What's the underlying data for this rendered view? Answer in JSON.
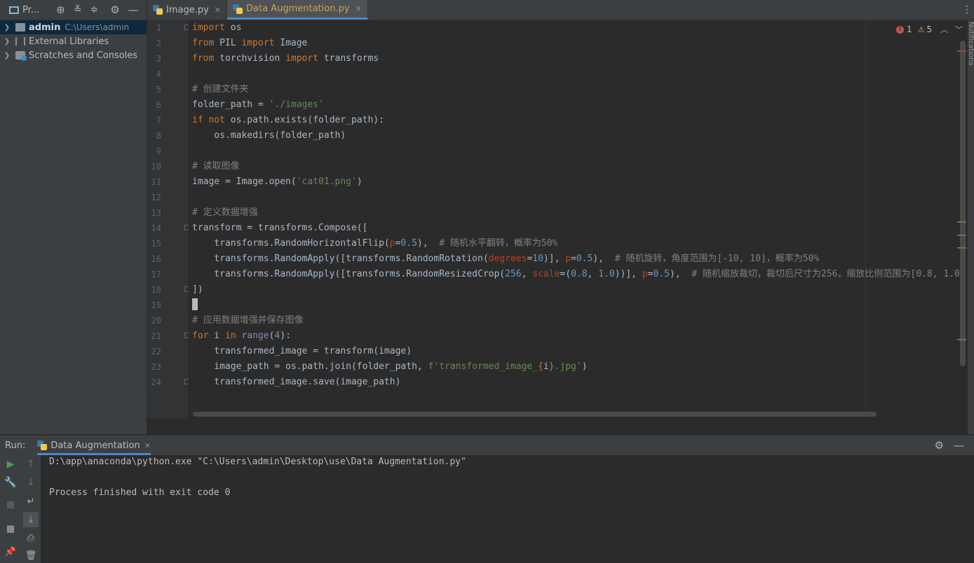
{
  "project": {
    "title": "Pr...",
    "tree": [
      {
        "name": "admin",
        "path": "C:\\Users\\admin"
      },
      {
        "name": "External Libraries"
      },
      {
        "name": "Scratches and Consoles"
      }
    ]
  },
  "tabs": [
    {
      "label": "Image.py"
    },
    {
      "label": "Data Augmentation.py"
    }
  ],
  "inspection": {
    "errors": "1",
    "warnings": "5"
  },
  "notifications_label": "Notifications",
  "line_numbers": [
    "1",
    "2",
    "3",
    "4",
    "5",
    "6",
    "7",
    "8",
    "9",
    "10",
    "11",
    "12",
    "13",
    "14",
    "15",
    "16",
    "17",
    "18",
    "19",
    "20",
    "21",
    "22",
    "23",
    "24"
  ],
  "code": {
    "l1": [
      "import",
      " os"
    ],
    "l2": [
      "from",
      " PIL ",
      "import",
      " Image"
    ],
    "l3": [
      "from",
      " torchvision ",
      "import",
      " transforms"
    ],
    "l5": "# 创建文件夹",
    "l6": [
      "folder_path = ",
      "'./images'"
    ],
    "l7": [
      "if not",
      " os.path.exists(folder_path):"
    ],
    "l8": "    os.makedirs(folder_path)",
    "l10": "# 读取图像",
    "l11": [
      "image = Image.open(",
      "'cat01.png'",
      ")"
    ],
    "l13": "# 定义数据增强",
    "l14": "transform = transforms.Compose([",
    "l15": [
      "    transforms.RandomHorizontalFlip(",
      "p",
      "=",
      "0.5",
      "),  ",
      "# 随机水平翻转，概率为50%"
    ],
    "l16": [
      "    transforms.RandomApply([transforms.RandomRotation(",
      "degrees",
      "=",
      "10",
      ")], ",
      "p",
      "=",
      "0.5",
      "),  ",
      "# 随机旋转，角度范围为[-10, 10]，概率为50%"
    ],
    "l17": [
      "    transforms.RandomApply([transforms.RandomResizedCrop(",
      "256",
      ", ",
      "scale",
      "=(",
      "0.8",
      ", ",
      "1.0",
      "))], ",
      "p",
      "=",
      "0.5",
      "),  ",
      "# 随机缩放裁切，裁切后尺寸为256，缩放比例范围为[0.8, 1.0"
    ],
    "l18": "])",
    "l20": "# 应用数据增强并保存图像",
    "l21": [
      "for",
      " i ",
      "in",
      " ",
      "range",
      "(",
      "4",
      "):"
    ],
    "l22": "    transformed_image = transform(image)",
    "l23": [
      "    image_path = os.path.join(folder_path, ",
      "f'transformed_image_",
      "{",
      "i",
      "}",
      ".jpg'",
      ")"
    ],
    "l24": "    transformed_image.save(image_path)"
  },
  "run": {
    "label": "Run:",
    "config": "Data Augmentation",
    "command": "D:\\app\\anaconda\\python.exe \"C:\\Users\\admin\\Desktop\\use\\Data Augmentation.py\"",
    "result": "Process finished with exit code 0"
  },
  "colors": {
    "keyword": "#cc7832",
    "string": "#6a8759",
    "number": "#6897bb",
    "comment": "#808080",
    "param": "#aa4926",
    "builtin": "#8888c6",
    "accent": "#4a88c7"
  }
}
